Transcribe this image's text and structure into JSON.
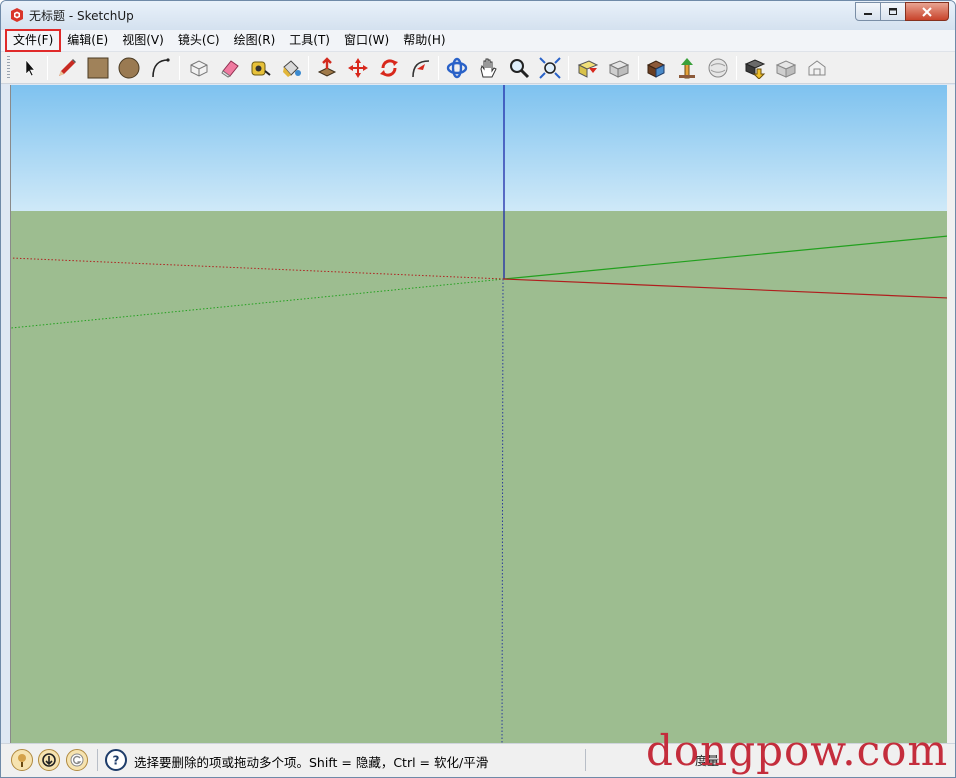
{
  "window": {
    "title": "无标题 - SketchUp",
    "app_icon": "sketchup-logo-icon",
    "buttons": [
      "minimize-icon",
      "maximize-icon",
      "close-icon"
    ]
  },
  "menubar": {
    "items": [
      {
        "label": "文件(F)",
        "highlighted": true
      },
      {
        "label": "编辑(E)"
      },
      {
        "label": "视图(V)"
      },
      {
        "label": "镜头(C)"
      },
      {
        "label": "绘图(R)"
      },
      {
        "label": "工具(T)"
      },
      {
        "label": "窗口(W)"
      },
      {
        "label": "帮助(H)"
      }
    ]
  },
  "toolbar": {
    "tools": [
      "select-icon",
      "pencil-icon",
      "rectangle-icon",
      "circle-icon",
      "arc-icon",
      "make-component-icon",
      "eraser-icon",
      "tape-measure-icon",
      "paint-bucket-icon",
      "push-pull-icon",
      "move-icon",
      "rotate-icon",
      "follow-me-icon",
      "orbit-icon",
      "pan-icon",
      "zoom-icon",
      "zoom-extents-icon",
      "previous-view-icon",
      "next-view-icon",
      "get-models-icon",
      "share-model-icon",
      "share-component-icon",
      "get-photo-texture-icon",
      "add-location-icon",
      "toggle-terrain-icon"
    ]
  },
  "viewport": {
    "sky_color": "#7ec2ef",
    "ground_color": "#9dbd90",
    "axis_colors": {
      "red": "#b01e1e",
      "green": "#22a01e",
      "blue": "#1e2aa8"
    }
  },
  "statusbar": {
    "icons": [
      "geo-location-icon",
      "credits-icon",
      "user-account-icon",
      "help-icon"
    ],
    "message": "选择要删除的项或拖动多个项。Shift = 隐藏，Ctrl = 软化/平滑",
    "measurements_label": "度量"
  },
  "watermark": "dongpow.com"
}
